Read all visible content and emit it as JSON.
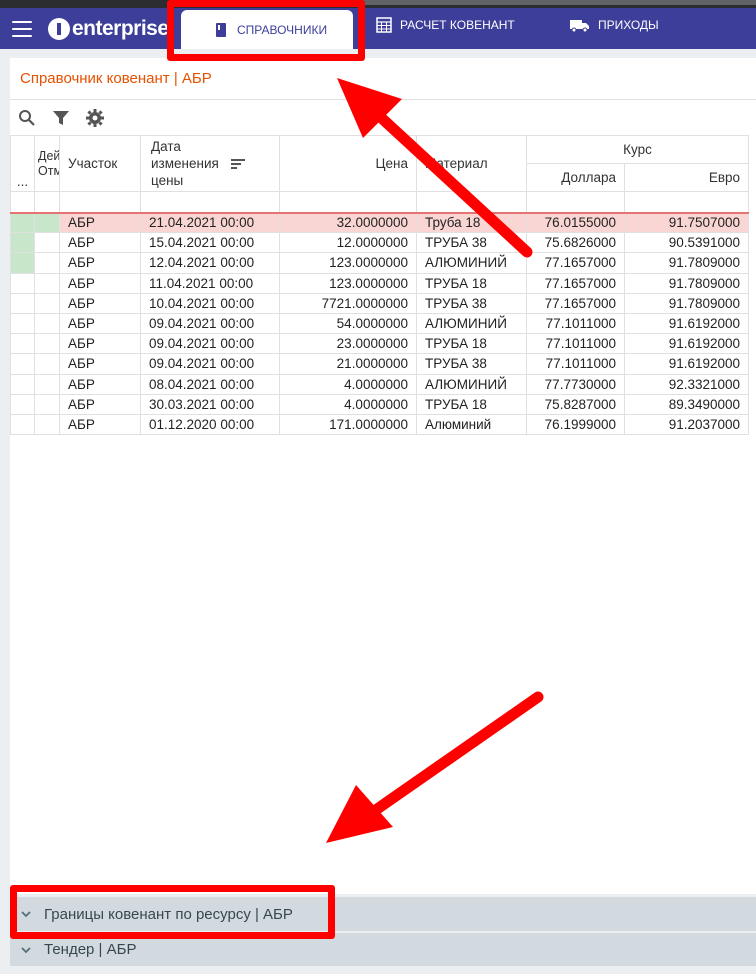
{
  "header": {
    "logo_text": "enterprise",
    "tabs": [
      {
        "label": "СПРАВОЧНИКИ",
        "icon": "book-icon",
        "active": true
      },
      {
        "label": "РАСЧЕТ КОВЕНАНТ",
        "icon": "calculator-icon"
      },
      {
        "label": "ПРИХОДЫ",
        "icon": "truck-icon"
      }
    ]
  },
  "panel": {
    "title": "Справочник ковенант | АБР"
  },
  "table": {
    "headers": {
      "col0": "...",
      "col1_line1": "Дей",
      "col1_line2": "Отм",
      "uchastok": "Участок",
      "date": "Дата изменения цены",
      "price": "Цена",
      "material": "Материал",
      "kurs": "Курс",
      "dollar": "Доллара",
      "euro": "Евро"
    },
    "rows": [
      {
        "uchastok": "АБР",
        "date": "21.04.2021 00:00",
        "price": "32.0000000",
        "material": "Труба 18",
        "dollar": "76.0155000",
        "euro": "91.7507000"
      },
      {
        "uchastok": "АБР",
        "date": "15.04.2021 00:00",
        "price": "12.0000000",
        "material": "ТРУБА 38",
        "dollar": "75.6826000",
        "euro": "90.5391000"
      },
      {
        "uchastok": "АБР",
        "date": "12.04.2021 00:00",
        "price": "123.0000000",
        "material": "АЛЮМИНИЙ",
        "dollar": "77.1657000",
        "euro": "91.7809000"
      },
      {
        "uchastok": "АБР",
        "date": "11.04.2021 00:00",
        "price": "123.0000000",
        "material": "ТРУБА 18",
        "dollar": "77.1657000",
        "euro": "91.7809000"
      },
      {
        "uchastok": "АБР",
        "date": "10.04.2021 00:00",
        "price": "7721.0000000",
        "material": "ТРУБА 38",
        "dollar": "77.1657000",
        "euro": "91.7809000"
      },
      {
        "uchastok": "АБР",
        "date": "09.04.2021 00:00",
        "price": "54.0000000",
        "material": "АЛЮМИНИЙ",
        "dollar": "77.1011000",
        "euro": "91.6192000"
      },
      {
        "uchastok": "АБР",
        "date": "09.04.2021 00:00",
        "price": "23.0000000",
        "material": "ТРУБА 18",
        "dollar": "77.1011000",
        "euro": "91.6192000"
      },
      {
        "uchastok": "АБР",
        "date": "09.04.2021 00:00",
        "price": "21.0000000",
        "material": "ТРУБА 38",
        "dollar": "77.1011000",
        "euro": "91.6192000"
      },
      {
        "uchastok": "АБР",
        "date": "08.04.2021 00:00",
        "price": "4.0000000",
        "material": "АЛЮМИНИЙ",
        "dollar": "77.7730000",
        "euro": "92.3321000"
      },
      {
        "uchastok": "АБР",
        "date": "30.03.2021 00:00",
        "price": "4.0000000",
        "material": "ТРУБА 18",
        "dollar": "75.8287000",
        "euro": "89.3490000"
      },
      {
        "uchastok": "АБР",
        "date": "01.12.2020 00:00",
        "price": "171.0000000",
        "material": "Алюминий",
        "dollar": "76.1999000",
        "euro": "91.2037000"
      }
    ]
  },
  "sections": [
    {
      "label": "Границы ковенант по ресурсу | АБР"
    },
    {
      "label": "Тендер | АБР"
    }
  ],
  "colors": {
    "header_bg": "#3c3e99",
    "title_accent": "#e65100",
    "selected_row": "#f9d6d3",
    "marker_green": "#c8e6c9",
    "annotation_red": "#ff0000"
  }
}
